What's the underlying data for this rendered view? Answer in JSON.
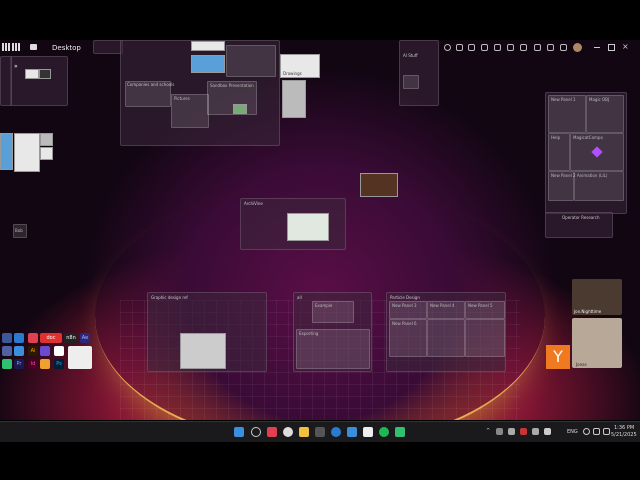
{
  "topbar": {
    "label": "Desktop"
  },
  "boards": {
    "categories": "Companies and schools",
    "pictures": "Pictures",
    "samples": "Sandbox Presentation",
    "drawings": "Drawings",
    "ai": "AI Stuff",
    "newpanel": "New Panel",
    "archive": "ArchiVine",
    "graphic": "Graphic design ref",
    "all": "all",
    "particle": "Particle Design",
    "research": "Operator Research"
  },
  "cards": {
    "examples": "Example",
    "exporting": "Exporting",
    "np1": "New Panel 1",
    "np2": "New Panel 2",
    "np3": "New Panel 3",
    "np4": "New Panel 4",
    "np5": "New Panel 5",
    "np6": "New Panel 6",
    "magicant": "MagicatCompo",
    "magic": "Magic OBJ",
    "help": "Help",
    "animation": "Animation (LIL)"
  },
  "avatars": {
    "a": "Jon.Nighttime",
    "b": "Jonas"
  },
  "y_label": "Y",
  "side_note": "Bob",
  "apps": [
    "doc",
    "n8n",
    "Ae",
    "Ai",
    "Pr",
    "Id",
    "Ps"
  ],
  "clock": {
    "time": "1:36 PM",
    "date": "5/21/2025"
  },
  "tray": {
    "lang": "ENG"
  }
}
